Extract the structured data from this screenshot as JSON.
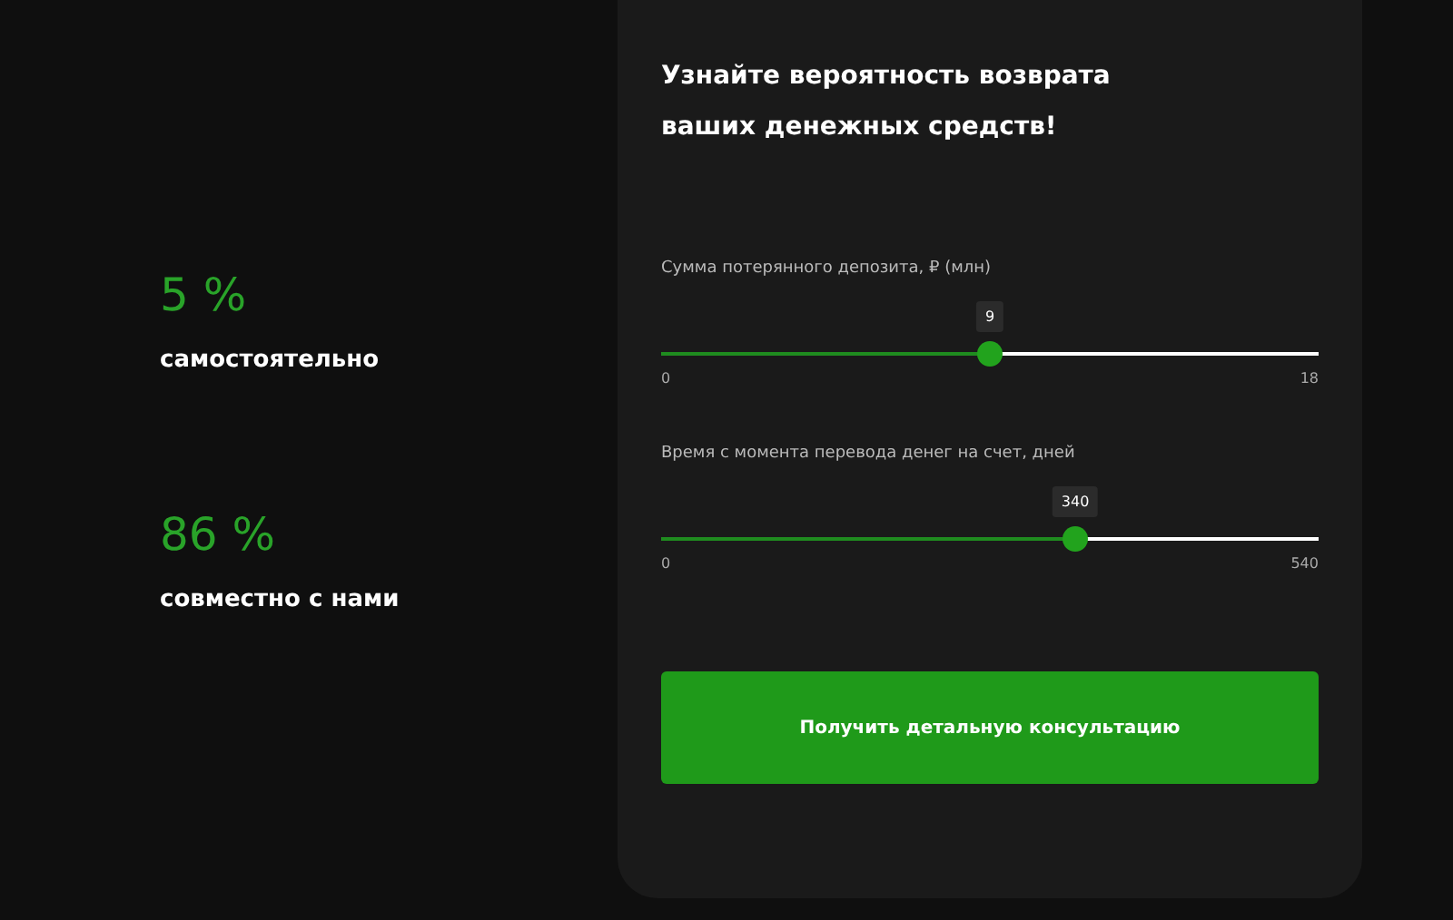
{
  "stats": [
    {
      "value": "5 %",
      "label": "самостоятельно"
    },
    {
      "value": "86 %",
      "label": "совместно с нами"
    }
  ],
  "calculator": {
    "title": "Узнайте вероятность возврата ваших денежных средств!",
    "sliders": [
      {
        "label": "Сумма потерянного депозита, ₽ (млн)",
        "value": "9",
        "min": "0",
        "max": "18",
        "level": 0.5
      },
      {
        "label": "Время с момента перевода денег на счет, дней",
        "value": "340",
        "min": "0",
        "max": "540",
        "level": 0.63
      }
    ],
    "button": "Получить детальную консультацию"
  }
}
